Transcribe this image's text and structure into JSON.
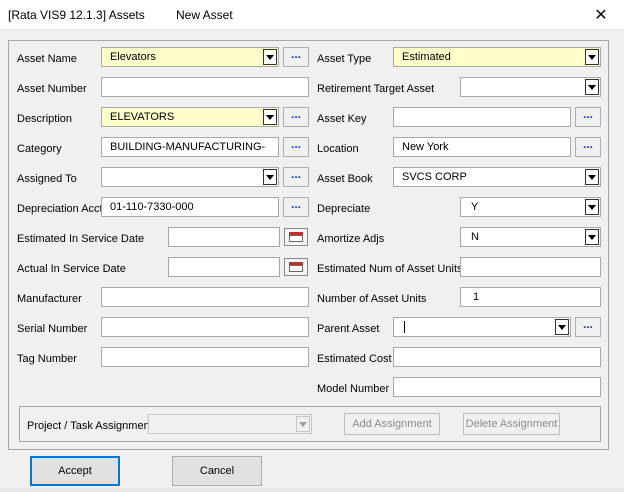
{
  "titlebar": {
    "app": "[Rata VIS9 12.1.3] Assets",
    "window": "New Asset",
    "close_icon": "close-icon"
  },
  "left": {
    "asset_name": {
      "label": "Asset Name",
      "value": "Elevators"
    },
    "asset_number": {
      "label": "Asset Number",
      "value": ""
    },
    "description": {
      "label": "Description",
      "value": "ELEVATORS"
    },
    "category": {
      "label": "Category",
      "value": "BUILDING-MANUFACTURING-"
    },
    "assigned_to": {
      "label": "Assigned To",
      "value": ""
    },
    "depreciation_acct": {
      "label": "Depreciation Acct",
      "value": "01-110-7330-000"
    },
    "est_in_service": {
      "label": "Estimated In Service Date",
      "value": ""
    },
    "act_in_service": {
      "label": "Actual In Service Date",
      "value": ""
    },
    "manufacturer": {
      "label": "Manufacturer",
      "value": ""
    },
    "serial_number": {
      "label": "Serial Number",
      "value": ""
    },
    "tag_number": {
      "label": "Tag Number",
      "value": ""
    }
  },
  "right": {
    "asset_type": {
      "label": "Asset Type",
      "value": "Estimated"
    },
    "retirement_target": {
      "label": "Retirement Target Asset",
      "value": ""
    },
    "asset_key": {
      "label": "Asset Key",
      "value": ""
    },
    "location": {
      "label": "Location",
      "value": "New York"
    },
    "asset_book": {
      "label": "Asset Book",
      "value": "SVCS CORP"
    },
    "depreciate": {
      "label": "Depreciate",
      "value": "Y"
    },
    "amortize_adjs": {
      "label": "Amortize Adjs",
      "value": "N"
    },
    "est_num_units": {
      "label": "Estimated Num of Asset Units",
      "value": ""
    },
    "num_units": {
      "label": "Number of Asset Units",
      "value": "1"
    },
    "parent_asset": {
      "label": "Parent Asset",
      "value": ""
    },
    "estimated_cost": {
      "label": "Estimated Cost",
      "value": ""
    },
    "model_number": {
      "label": "Model Number",
      "value": ""
    }
  },
  "lookup_glyph": "...",
  "assignment": {
    "label": "Project / Task Assignment",
    "value": "",
    "add_label": "Add Assignment",
    "delete_label": "Delete Assignment"
  },
  "buttons": {
    "accept": "Accept",
    "cancel": "Cancel"
  },
  "colors": {
    "required_bg": "#ffffcc",
    "lookup_dots": "#1a3fcc",
    "default_button_border": "#0078d7"
  }
}
